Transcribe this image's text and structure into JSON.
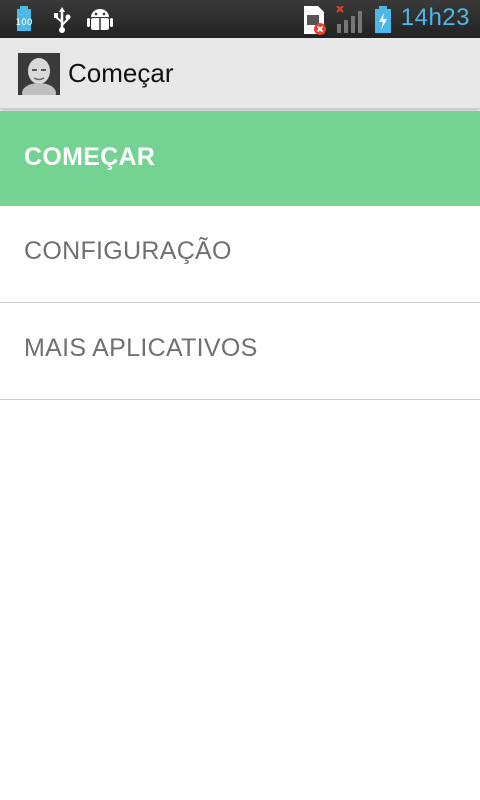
{
  "status_bar": {
    "battery_saver_label": "100",
    "time": "14h23",
    "icons": [
      "battery-100-icon",
      "usb-icon",
      "android-debug-icon",
      "no-sim-icon",
      "signal-off-icon",
      "battery-charging-icon"
    ],
    "accent_color": "#4db8e8"
  },
  "action_bar": {
    "title": "Começar",
    "avatar_icon": "avatar"
  },
  "menu": {
    "items": [
      {
        "label": "COMEÇAR",
        "active": true
      },
      {
        "label": "CONFIGURAÇÃO",
        "active": false
      },
      {
        "label": "MAIS APLICATIVOS",
        "active": false
      }
    ],
    "active_color": "#74d392"
  }
}
